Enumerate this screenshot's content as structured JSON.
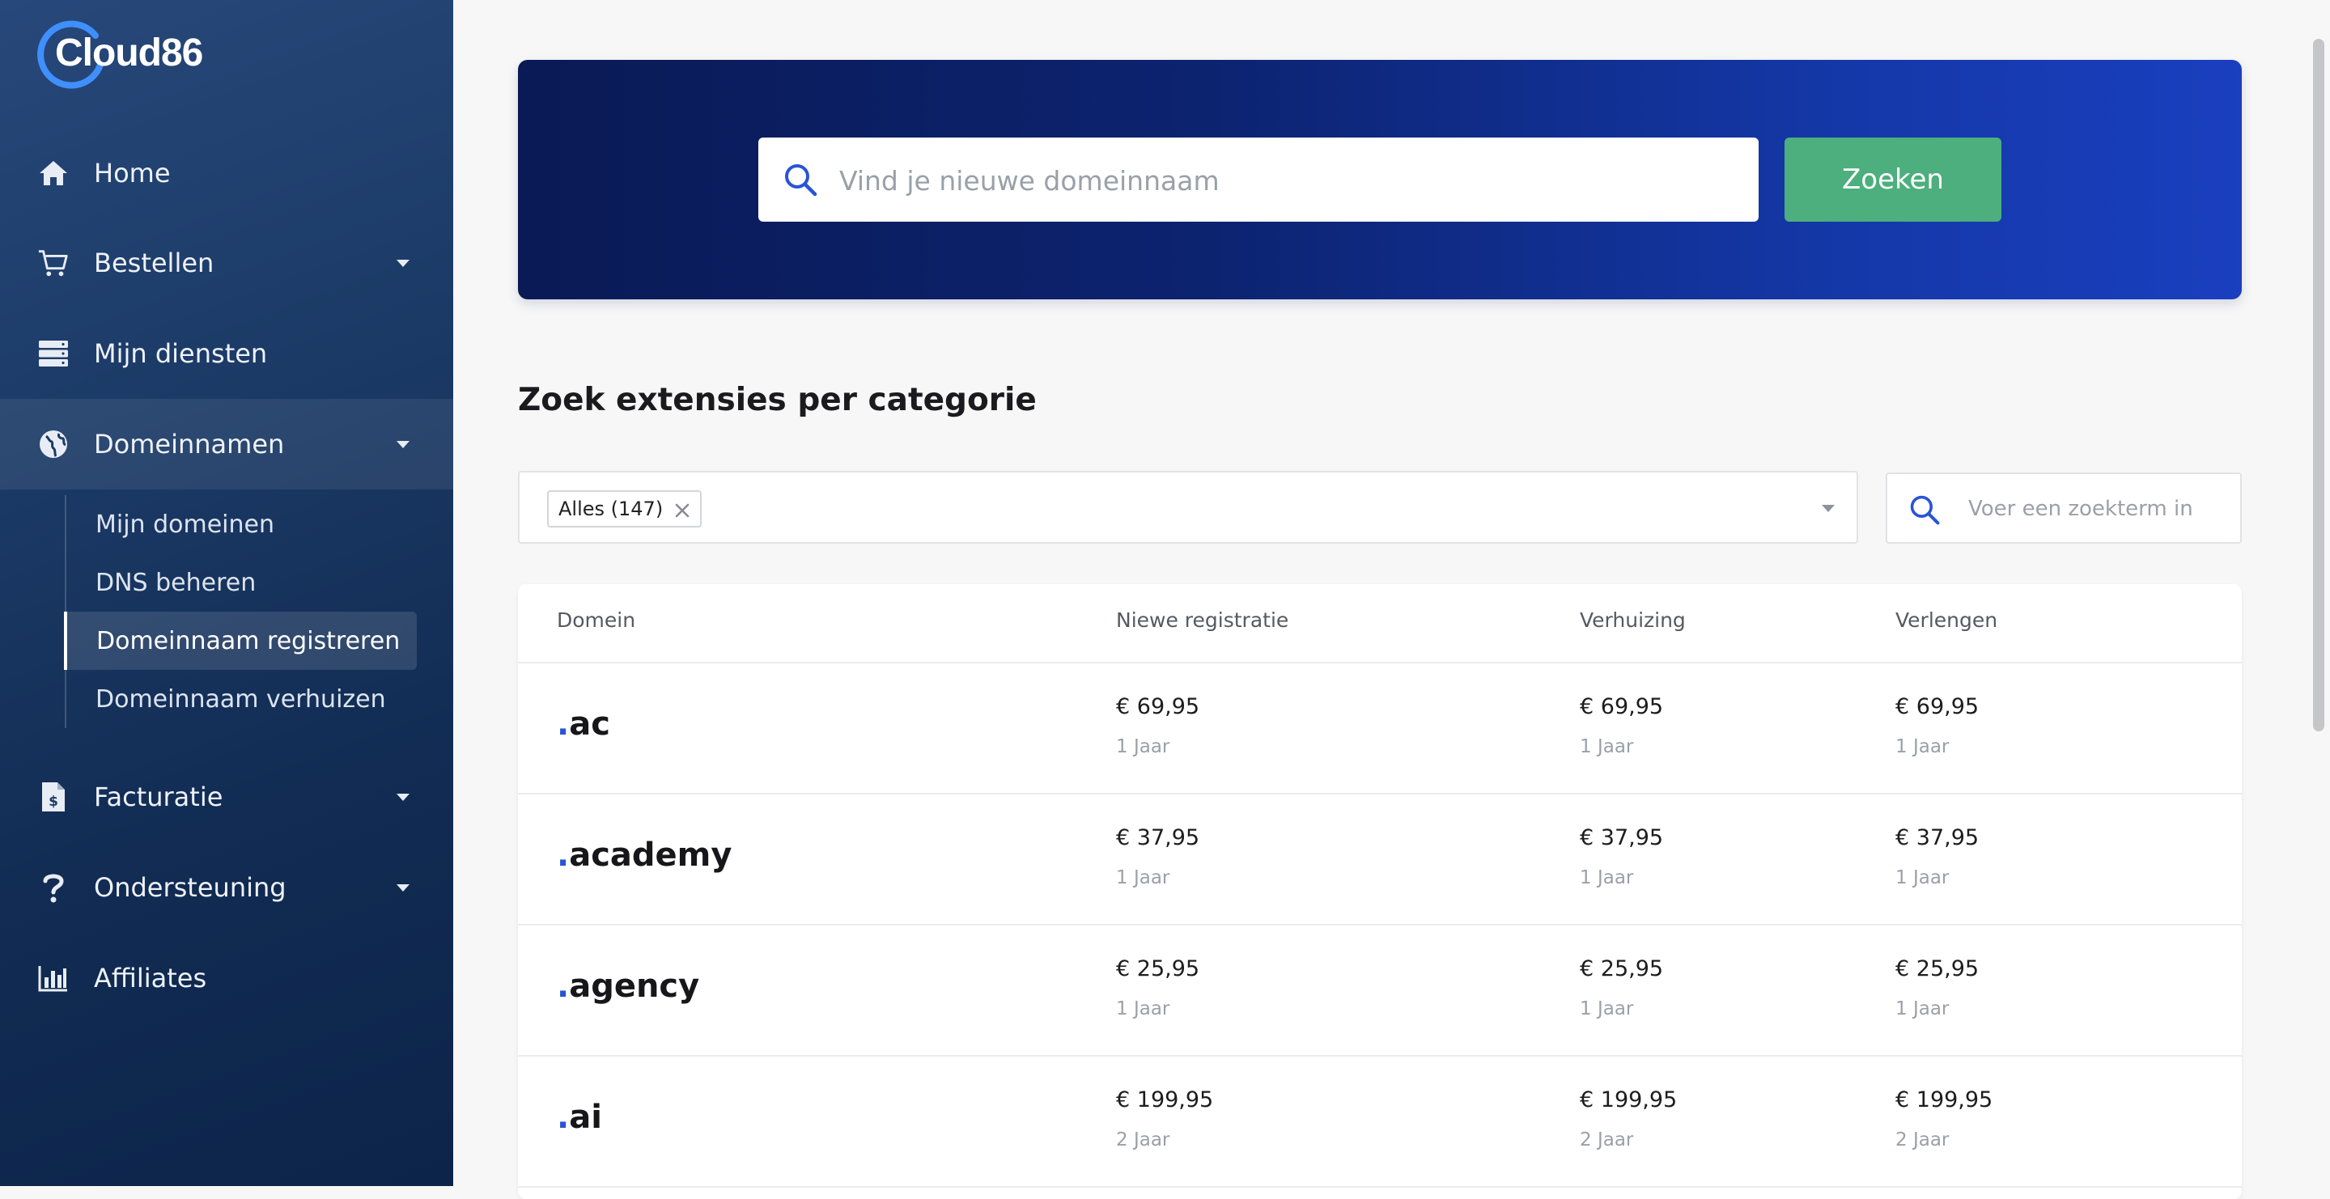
{
  "brand": {
    "name": "Cloud86",
    "accent": "#2854d6"
  },
  "sidebar": {
    "items": [
      {
        "label": "Home",
        "icon": "home-icon"
      },
      {
        "label": "Bestellen",
        "icon": "cart-icon"
      },
      {
        "label": "Mijn diensten",
        "icon": "server-icon"
      },
      {
        "label": "Domeinnamen",
        "icon": "globe-icon"
      },
      {
        "label": "Facturatie",
        "icon": "invoice-icon"
      },
      {
        "label": "Ondersteuning",
        "icon": "question-icon"
      },
      {
        "label": "Affiliates",
        "icon": "chart-bar-icon"
      }
    ],
    "sub_items": [
      {
        "label": "Mijn domeinen"
      },
      {
        "label": "DNS beheren"
      },
      {
        "label": "Domeinnaam registreren"
      },
      {
        "label": "Domeinnaam verhuizen"
      }
    ]
  },
  "hero": {
    "search_placeholder": "Vind je nieuwe domeinnaam",
    "search_button": "Zoeken"
  },
  "section": {
    "title": "Zoek extensies per categorie",
    "filter_chip": "Alles (147)",
    "term_placeholder": "Voer een zoekterm in"
  },
  "table": {
    "headers": [
      "Domein",
      "Niewe registratie",
      "Verhuizing",
      "Verlengen"
    ],
    "rows": [
      {
        "ext": "ac",
        "prices": [
          "€ 69,95",
          "€ 69,95",
          "€ 69,95"
        ],
        "periods": [
          "1 Jaar",
          "1 Jaar",
          "1 Jaar"
        ]
      },
      {
        "ext": "academy",
        "prices": [
          "€ 37,95",
          "€ 37,95",
          "€ 37,95"
        ],
        "periods": [
          "1 Jaar",
          "1 Jaar",
          "1 Jaar"
        ]
      },
      {
        "ext": "agency",
        "prices": [
          "€ 25,95",
          "€ 25,95",
          "€ 25,95"
        ],
        "periods": [
          "1 Jaar",
          "1 Jaar",
          "1 Jaar"
        ]
      },
      {
        "ext": "ai",
        "prices": [
          "€ 199,95",
          "€ 199,95",
          "€ 199,95"
        ],
        "periods": [
          "2 Jaar",
          "2 Jaar",
          "2 Jaar"
        ]
      }
    ]
  }
}
